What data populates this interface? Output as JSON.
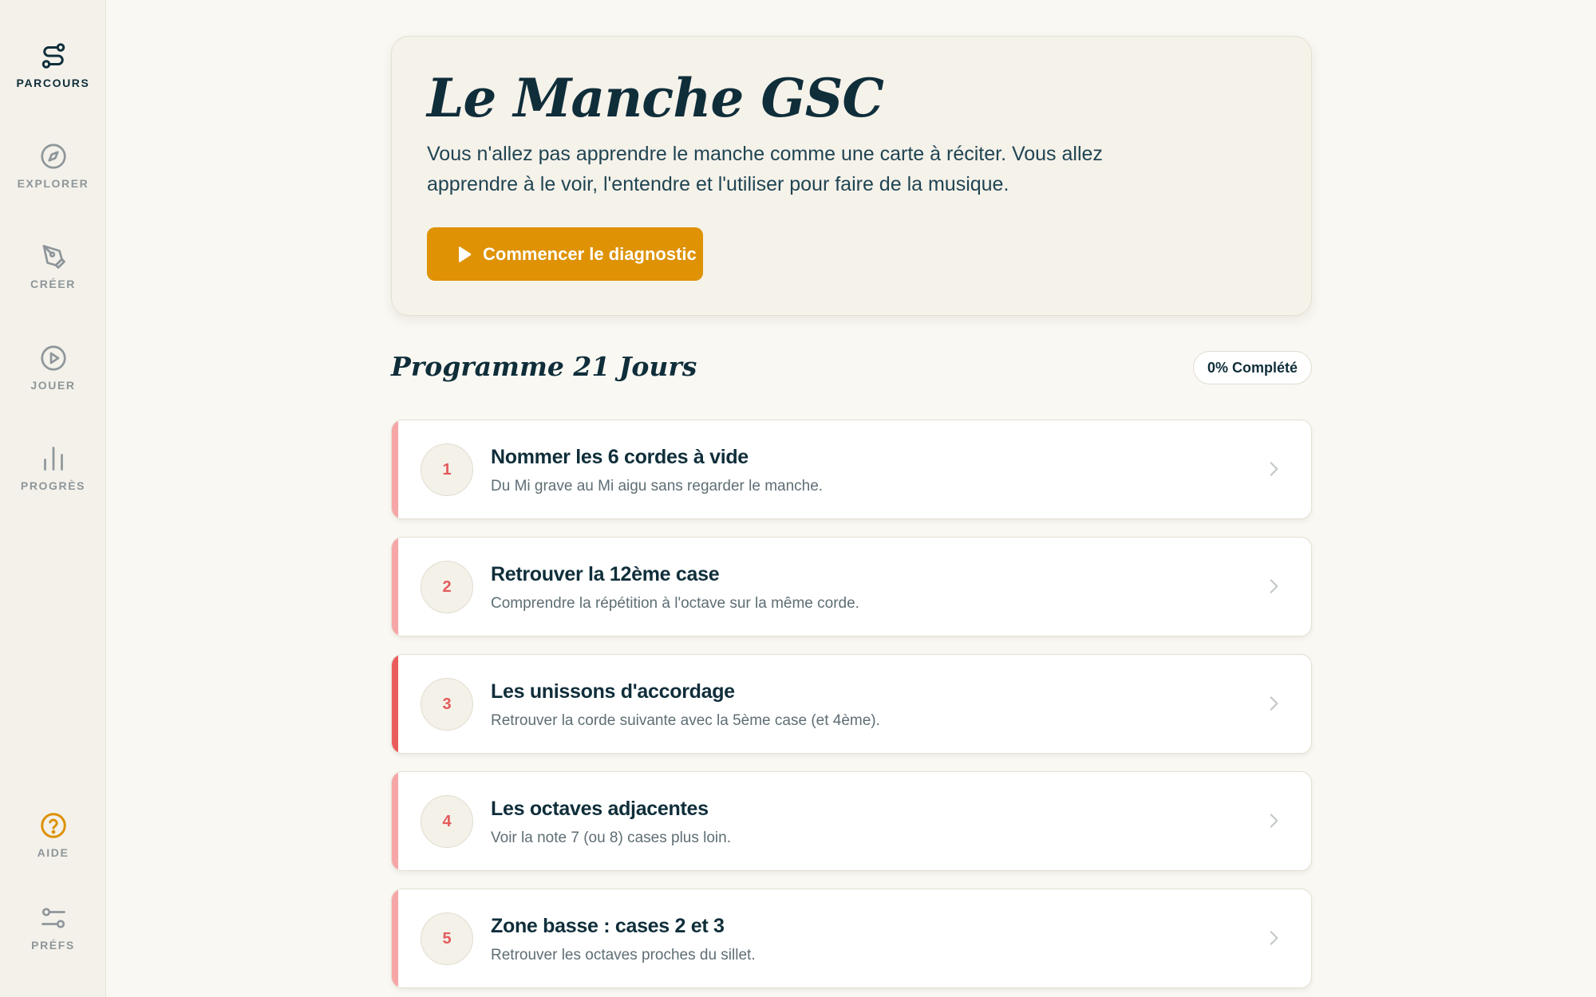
{
  "sidebar": {
    "items": [
      {
        "label": "PARCOURS",
        "icon": "route-icon"
      },
      {
        "label": "EXPLORER",
        "icon": "compass-icon"
      },
      {
        "label": "CRÉER",
        "icon": "pen-nib-icon"
      },
      {
        "label": "JOUER",
        "icon": "play-circle-icon"
      },
      {
        "label": "PROGRÈS",
        "icon": "bar-chart-icon"
      }
    ],
    "bottom": [
      {
        "label": "AIDE",
        "icon": "help-circle-icon"
      },
      {
        "label": "PRÉFS",
        "icon": "sliders-icon"
      }
    ]
  },
  "hero": {
    "title": "Le Manche GSC",
    "description": "Vous n'allez pas apprendre le manche comme une carte à réciter. Vous allez apprendre à le voir, l'entendre et l'utiliser pour faire de la musique.",
    "cta_label": "Commencer le diagnostic"
  },
  "program": {
    "title": "Programme 21 Jours",
    "progress_label": "0% Complété",
    "lessons": [
      {
        "number": "1",
        "title": "Nommer les 6 cordes à vide",
        "description": "Du Mi grave au Mi aigu sans regarder le manche."
      },
      {
        "number": "2",
        "title": "Retrouver la 12ème case",
        "description": "Comprendre la répétition à l'octave sur la même corde."
      },
      {
        "number": "3",
        "title": "Les unissons d'accordage",
        "description": "Retrouver la corde suivante avec la 5ème case (et 4ème)."
      },
      {
        "number": "4",
        "title": "Les octaves adjacentes",
        "description": "Voir la note 7 (ou 8) cases plus loin."
      },
      {
        "number": "5",
        "title": "Zone basse : cases 2 et 3",
        "description": "Retrouver les octaves proches du sillet."
      }
    ]
  },
  "colors": {
    "accent": "#de9204",
    "lesson_accent": "#f6a6a6",
    "lesson_accent_active": "#ea5c5c",
    "text_dark": "#0f2e3a"
  }
}
